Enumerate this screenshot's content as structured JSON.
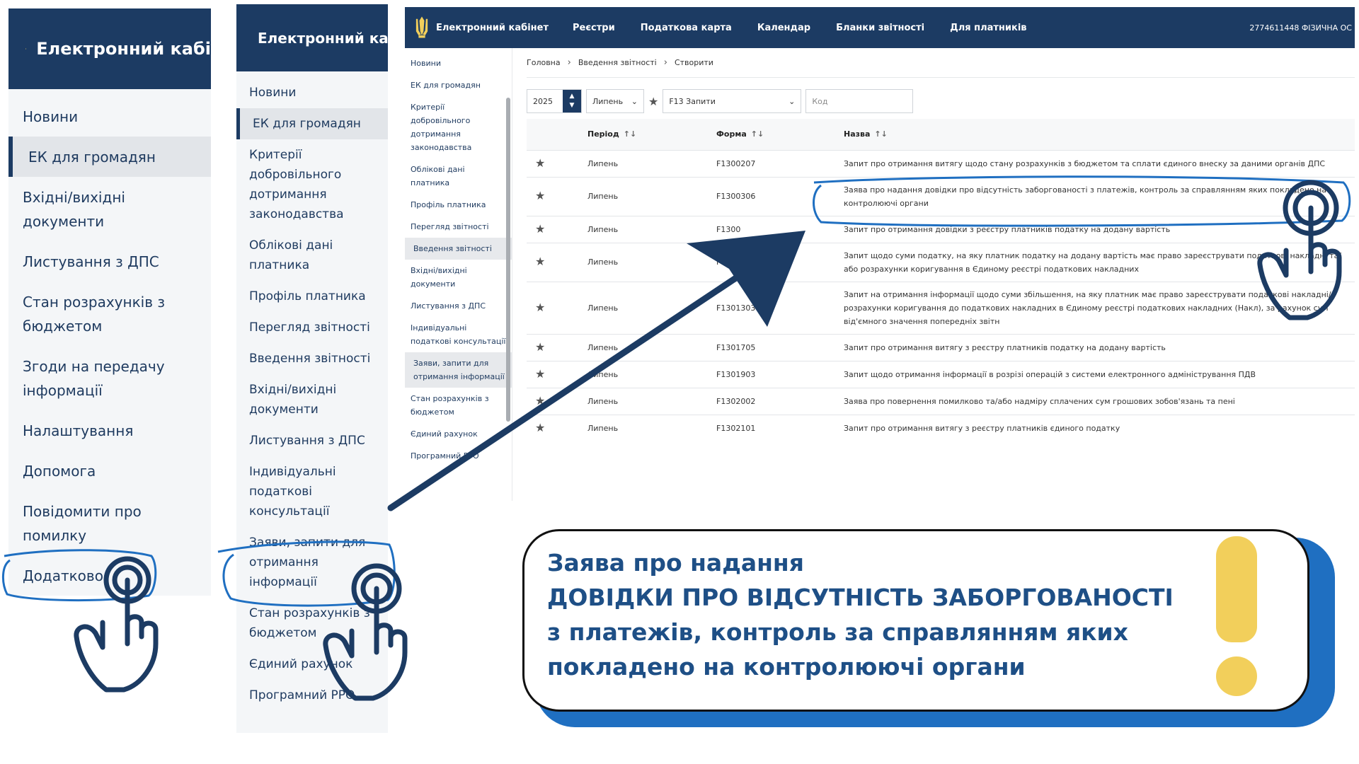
{
  "panel_large": {
    "title": "Електронний кабі",
    "nav": [
      "Новини",
      "ЕК для громадян",
      "Вхідні/вихідні документи",
      "Листування з ДПС",
      "Стан розрахунків з бюджетом",
      "Згоди на передачу інформації",
      "Налаштування",
      "Допомога",
      "Повідомити про помилку",
      "Додатково"
    ],
    "active_index": 1
  },
  "panel_medium": {
    "title": "Електронний ка",
    "nav": [
      "Новини",
      "ЕК для громадян",
      "Критерії добровільного дотримання законодавства",
      "Облікові дані платника",
      "Профіль платника",
      "Перегляд звітності",
      "Введення звітності",
      "Вхідні/вихідні документи",
      "Листування з ДПС",
      "Індивідуальні податкові консультації",
      "Заяви, запити для отримання інформації",
      "Стан розрахунків з бюджетом",
      "Єдиний рахунок",
      "Програмний РРО"
    ],
    "active_index": 1
  },
  "screen": {
    "brand": "Електронний кабінет",
    "menu": [
      "Реєстри",
      "Податкова карта",
      "Календар",
      "Бланки звітності",
      "Для платників"
    ],
    "user": "2774611448 ФІЗИЧНА ОС",
    "sidebar": [
      "Новини",
      "ЕК для громадян",
      "Критерії добровільного дотримання законодавства",
      "Облікові дані платника",
      "Профіль платника",
      "Перегляд звітності",
      "Введення звітності",
      "Вхідні/вихідні документи",
      "Листування з ДПС",
      "Індивідуальні податкові консультації",
      "Заяви, запити для отримання інформації",
      "Стан розрахунків з бюджетом",
      "Єдиний рахунок",
      "Програмний РРО"
    ],
    "sidebar_selected": [
      6,
      10
    ],
    "breadcrumb": [
      "Головна",
      "Введення звітності",
      "Створити"
    ],
    "filters": {
      "year": "2025",
      "month": "Липень",
      "form_type": "F13 Запити",
      "code_placeholder": "Код"
    },
    "table": {
      "columns": [
        "Період",
        "Форма",
        "Назва"
      ],
      "rows": [
        {
          "period": "Липень",
          "form": "F1300207",
          "name": "Запит про отримання витягу щодо стану розрахунків з бюджетом та сплати єдиного внеску за даними органів ДПС"
        },
        {
          "period": "Липень",
          "form": "F1300306",
          "name": "Заява про надання довідки про відсутність заборгованості з платежів, контроль за справлянням яких покладено на контролюючі органи"
        },
        {
          "period": "Липень",
          "form": "F1300",
          "name": "Запит про отримання довідки з реєстру платників податку на додану вартість"
        },
        {
          "period": "Липень",
          "form": "F13006",
          "name": "Запит щодо суми податку, на яку платник податку на додану вартість має право зареєструвати податкові накладні та/або розрахунки коригування в Єдиному реєстрі податкових накладних"
        },
        {
          "period": "Липень",
          "form": "F1301303",
          "name": "Запит на отримання інформації щодо суми збільшення, на яку платник має право зареєструвати податкові накладні/розрахунки коригування до податкових накладних в Єдиному реєстрі податкових накладних (Накл), за рахунок сум від'ємного значення попередніх звітн"
        },
        {
          "period": "Липень",
          "form": "F1301705",
          "name": "Запит про отримання витягу з реєстру платників податку на додану вартість"
        },
        {
          "period": "Липень",
          "form": "F1301903",
          "name": "Запит щодо отримання інформації в розрізі операцій з системи електронного адміністрування ПДВ"
        },
        {
          "period": "Липень",
          "form": "F1302002",
          "name": "Заява про повернення помилково та/або надміру сплачених сум грошових зобов'язань та пені"
        },
        {
          "period": "Липень",
          "form": "F1302101",
          "name": "Запит про отримання витягу з реєстру платників єдиного податку"
        }
      ]
    }
  },
  "callout": {
    "lines": [
      "Заява про надання",
      "ДОВІДКИ ПРО ВІДСУТНІСТЬ ЗАБОРГОВАНОСТІ",
      "з платежів, контроль за справлянням яких",
      "покладено на контролюючі органи"
    ]
  },
  "colors": {
    "navy": "#1c3b63",
    "accent_blue": "#1f6fc1",
    "callout_text": "#1e4f86",
    "exclamation": "#f2cf5b"
  },
  "icons": {
    "emblem": "tryzub-icon",
    "hand": "tap-hand-icon",
    "star": "star-icon",
    "arrow": "arrow-icon"
  }
}
